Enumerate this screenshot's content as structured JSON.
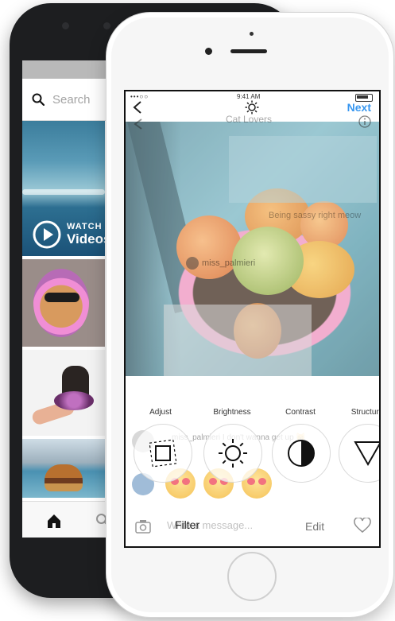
{
  "back_phone": {
    "search_placeholder": "Search",
    "video_tile": {
      "watch_label": "WATCH",
      "video_label": "Videos"
    },
    "icons": [
      "search-icon",
      "play-icon",
      "home-icon",
      "search-icon"
    ]
  },
  "front_phone": {
    "status": {
      "carrier": "•••○○",
      "time": "9:41 AM"
    },
    "nav": {
      "next_label": "Next"
    },
    "ghost_chat": {
      "title": "Cat Lovers",
      "message_1": "Being sassy right meow",
      "username": "miss_palmieri",
      "message_2": "miss_palmieri I don't wanna get up 😸",
      "placeholder": "Write a message..."
    },
    "tools": [
      {
        "label": "Adjust",
        "icon": "adjust-icon"
      },
      {
        "label": "Brightness",
        "icon": "brightness-icon"
      },
      {
        "label": "Contrast",
        "icon": "contrast-icon"
      },
      {
        "label": "Structure",
        "icon": "structure-icon"
      }
    ],
    "tabs": {
      "filter": "Filter",
      "edit": "Edit"
    },
    "colors": {
      "accent": "#3897f0"
    }
  }
}
